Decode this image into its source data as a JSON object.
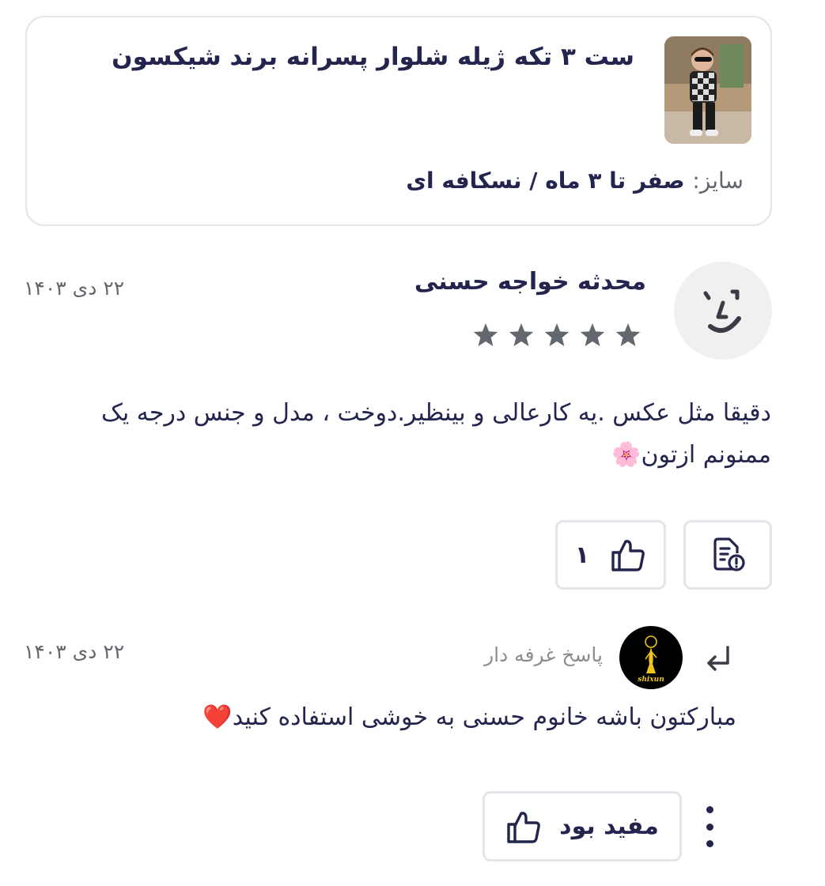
{
  "product": {
    "title": "ست ۳ تکه ژیله شلوار پسرانه برند شیکسون",
    "variant_key": "سایز:",
    "variant_value": " صفر تا ۳ ماه / نسکافه ای",
    "thumbnail_icon": "product-photo"
  },
  "review": {
    "author": "محدثه خواجه حسنی",
    "date": "۲۲ دی ۱۴۰۳",
    "rating": 5,
    "rating_max": 5,
    "text": "دقیقا مثل عکس .یه کارعالی و بینظیر.دوخت ، مدل و جنس درجه یک ممنونم ازتون🌸",
    "like_count": "۱",
    "avatar_icon": "smiley-face-icon"
  },
  "reply": {
    "label": "پاسخ غرفه دار",
    "date": "۲۲ دی ۱۴۰۳",
    "text": "مبارکتون باشه خانوم حسنی به خوشی استفاده کنید❤️",
    "seller_logo_text": "shixun",
    "helpful_label": "مفید بود"
  },
  "colors": {
    "text_primary": "#23254e",
    "text_secondary": "#62666d",
    "border": "#e4e4ea",
    "star": "#62666d",
    "logo_gold": "#f0c419"
  }
}
